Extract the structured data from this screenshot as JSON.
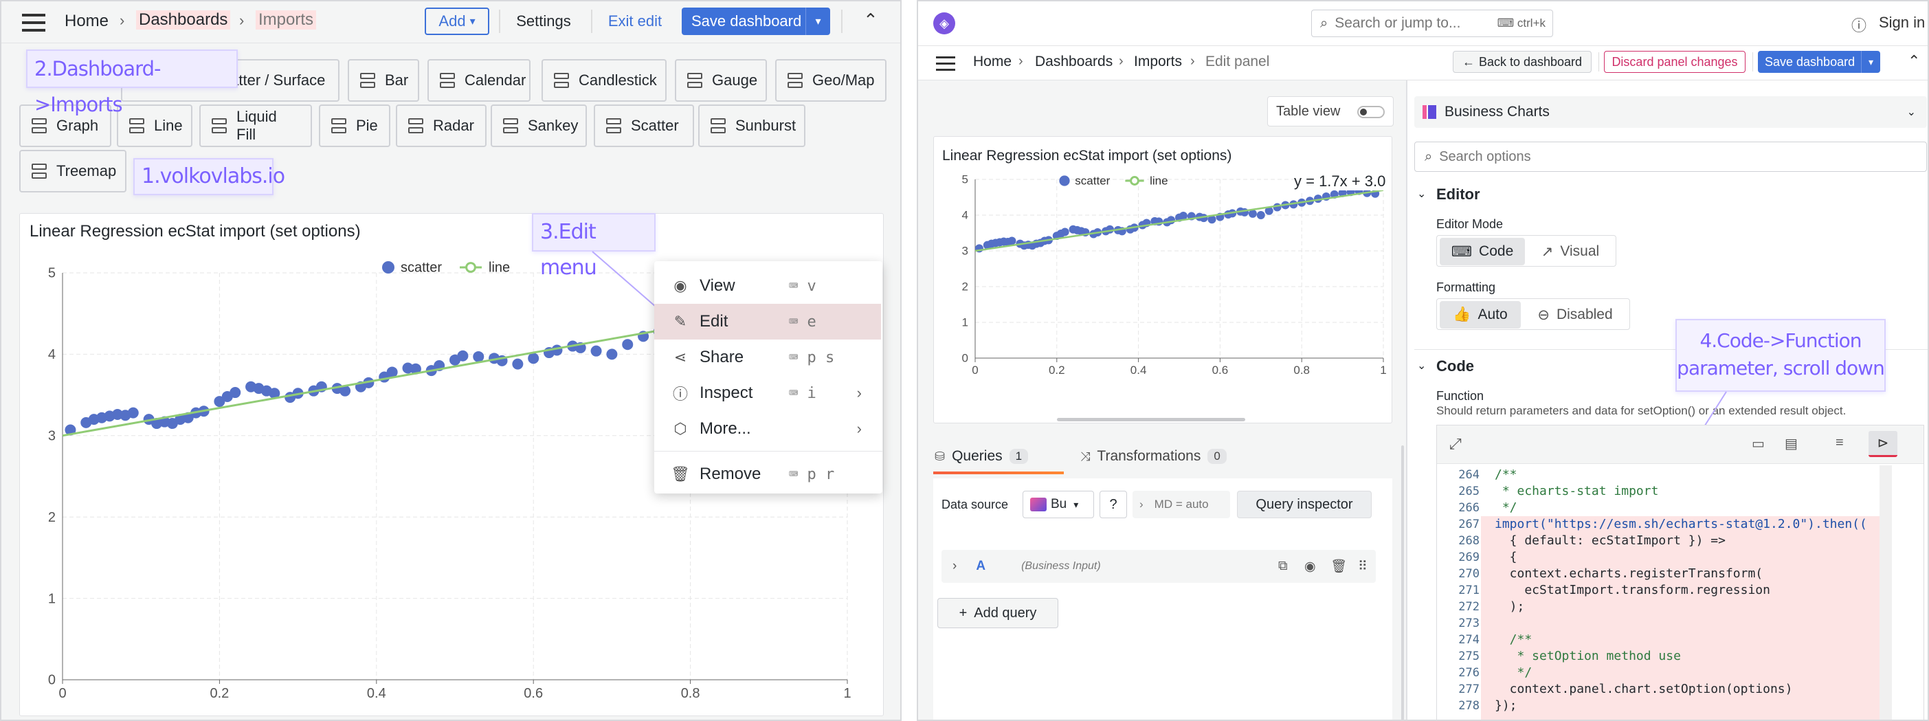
{
  "left": {
    "breadcrumb": {
      "home": "Home",
      "dashboards": "Dashboards",
      "imports": "Imports"
    },
    "toolbar": {
      "add": "Add",
      "settings": "Settings",
      "exit_edit": "Exit edit",
      "save": "Save dashboard"
    },
    "callouts": {
      "c1": "1.volkovlabs.io",
      "c2": "2.Dashboard->Imports",
      "c3": "3.Edit menu"
    },
    "links": [
      "3D Bar, Scatter / Surface",
      "Bar",
      "Calendar",
      "Candlestick",
      "Gauge",
      "Geo/Map",
      "Graph",
      "Line",
      "Liquid Fill",
      "Pie",
      "Radar",
      "Sankey",
      "Scatter",
      "Sunburst",
      "Treemap"
    ],
    "panel_title": "Linear Regression ecStat import (set options)",
    "menu": [
      {
        "label": "View",
        "key": "v"
      },
      {
        "label": "Edit",
        "key": "e"
      },
      {
        "label": "Share",
        "key": "p s"
      },
      {
        "label": "Inspect",
        "key": "i"
      },
      {
        "label": "More...",
        "key": ""
      },
      {
        "label": "Remove",
        "key": "p r"
      }
    ]
  },
  "right": {
    "search_placeholder": "Search or jump to...",
    "search_shortcut": "ctrl+k",
    "signin": "Sign in",
    "breadcrumb": {
      "home": "Home",
      "dashboards": "Dashboards",
      "imports": "Imports",
      "edit": "Edit panel"
    },
    "buttons": {
      "back": "Back to dashboard",
      "discard": "Discard panel changes",
      "save": "Save dashboard"
    },
    "table_view": "Table view",
    "panel_title": "Linear Regression ecStat import (set options)",
    "equation": "y = 1.7x + 3.0",
    "tabs": {
      "queries": "Queries",
      "queries_count": "1",
      "transformations": "Transformations",
      "transformations_count": "0"
    },
    "datasource": {
      "label": "Data source",
      "value": "Bu",
      "md": "MD = auto",
      "inspector": "Query inspector"
    },
    "query": {
      "letter": "A",
      "source": "(Business Input)"
    },
    "add_query": "Add query",
    "viz": "Business Charts",
    "options_search": "Search options",
    "editor": {
      "title": "Editor",
      "mode_label": "Editor Mode",
      "code": "Code",
      "visual": "Visual",
      "formatting_label": "Formatting",
      "auto": "Auto",
      "disabled": "Disabled"
    },
    "code": {
      "title": "Code",
      "function_label": "Function",
      "function_desc": "Should return parameters and data for setOption() or an extended result object."
    },
    "callout4": "4.Code->Function parameter, scroll down",
    "code_lines": [
      {
        "n": "264",
        "t": "/**"
      },
      {
        "n": "265",
        "t": " * echarts-stat import"
      },
      {
        "n": "266",
        "t": " */"
      },
      {
        "n": "267",
        "t": "import(\"https://esm.sh/echarts-stat@1.2.0\").then(("
      },
      {
        "n": "268",
        "t": "  { default: ecStatImport }) =>"
      },
      {
        "n": "269",
        "t": "  {"
      },
      {
        "n": "270",
        "t": "  context.echarts.registerTransform("
      },
      {
        "n": "271",
        "t": "    ecStatImport.transform.regression"
      },
      {
        "n": "272",
        "t": "  );"
      },
      {
        "n": "273",
        "t": ""
      },
      {
        "n": "274",
        "t": "  /**"
      },
      {
        "n": "275",
        "t": "   * setOption method use"
      },
      {
        "n": "276",
        "t": "   */"
      },
      {
        "n": "277",
        "t": "  context.panel.chart.setOption(options)"
      },
      {
        "n": "278",
        "t": "});"
      }
    ]
  },
  "chart_data": [
    {
      "type": "scatter",
      "title": "Linear Regression ecStat import (set options)",
      "legend": [
        "scatter",
        "line"
      ],
      "xlim": [
        0,
        1
      ],
      "ylim": [
        0,
        5
      ],
      "xticks": [
        "0",
        "0.2",
        "0.4",
        "0.6",
        "0.8",
        "1"
      ],
      "yticks": [
        "0",
        "1",
        "2",
        "3",
        "4",
        "5"
      ],
      "series": [
        {
          "name": "scatter",
          "x": [
            0.01,
            0.03,
            0.04,
            0.05,
            0.06,
            0.07,
            0.08,
            0.09,
            0.11,
            0.12,
            0.13,
            0.14,
            0.15,
            0.16,
            0.17,
            0.18,
            0.2,
            0.21,
            0.22,
            0.24,
            0.25,
            0.26,
            0.27,
            0.29,
            0.3,
            0.32,
            0.33,
            0.35,
            0.36,
            0.38,
            0.39,
            0.41,
            0.42,
            0.44,
            0.45,
            0.47,
            0.48,
            0.5,
            0.51,
            0.53,
            0.55,
            0.56,
            0.58,
            0.6,
            0.62,
            0.63,
            0.65,
            0.66,
            0.68,
            0.7,
            0.72,
            0.74,
            0.76,
            0.78,
            0.8,
            0.82,
            0.84,
            0.86,
            0.88,
            0.9,
            0.92,
            0.94,
            0.96,
            0.98
          ],
          "y": [
            3.07,
            3.16,
            3.2,
            3.22,
            3.24,
            3.26,
            3.25,
            3.28,
            3.2,
            3.15,
            3.17,
            3.15,
            3.2,
            3.22,
            3.28,
            3.3,
            3.42,
            3.48,
            3.53,
            3.6,
            3.58,
            3.55,
            3.52,
            3.47,
            3.52,
            3.55,
            3.6,
            3.58,
            3.55,
            3.6,
            3.65,
            3.72,
            3.78,
            3.83,
            3.82,
            3.8,
            3.86,
            3.93,
            3.98,
            3.97,
            3.95,
            3.92,
            3.88,
            3.95,
            4.02,
            4.05,
            4.1,
            4.08,
            4.04,
            4.0,
            4.12,
            4.22,
            4.28,
            4.3,
            4.35,
            4.4,
            4.46,
            4.52,
            4.58,
            4.62,
            4.65,
            4.68,
            4.62,
            4.6
          ]
        },
        {
          "name": "line",
          "x": [
            0,
            1
          ],
          "y": [
            3.0,
            4.7
          ]
        }
      ]
    },
    {
      "type": "scatter",
      "title": "Linear Regression ecStat import (set options)",
      "legend": [
        "scatter",
        "line"
      ],
      "xlim": [
        0,
        1
      ],
      "ylim": [
        0,
        5
      ],
      "xticks": [
        "0",
        "0.2",
        "0.4",
        "0.6",
        "0.8",
        "1"
      ],
      "yticks": [
        "0",
        "1",
        "2",
        "3",
        "4",
        "5"
      ],
      "series": [
        {
          "name": "scatter",
          "x": [
            0.01,
            0.03,
            0.04,
            0.05,
            0.06,
            0.07,
            0.08,
            0.09,
            0.11,
            0.12,
            0.13,
            0.14,
            0.15,
            0.16,
            0.17,
            0.18,
            0.2,
            0.21,
            0.22,
            0.24,
            0.25,
            0.26,
            0.27,
            0.29,
            0.3,
            0.32,
            0.33,
            0.35,
            0.36,
            0.38,
            0.39,
            0.41,
            0.42,
            0.44,
            0.45,
            0.47,
            0.48,
            0.5,
            0.51,
            0.53,
            0.55,
            0.56,
            0.58,
            0.6,
            0.62,
            0.63,
            0.65,
            0.66,
            0.68,
            0.7,
            0.72,
            0.74,
            0.76,
            0.78,
            0.8,
            0.82,
            0.84,
            0.86,
            0.88,
            0.9,
            0.92,
            0.94,
            0.96,
            0.98
          ],
          "y": [
            3.07,
            3.16,
            3.2,
            3.22,
            3.24,
            3.26,
            3.25,
            3.28,
            3.2,
            3.15,
            3.17,
            3.15,
            3.2,
            3.22,
            3.28,
            3.3,
            3.42,
            3.48,
            3.53,
            3.6,
            3.58,
            3.55,
            3.52,
            3.47,
            3.52,
            3.55,
            3.6,
            3.58,
            3.55,
            3.6,
            3.65,
            3.72,
            3.78,
            3.83,
            3.82,
            3.8,
            3.86,
            3.93,
            3.98,
            3.97,
            3.95,
            3.92,
            3.88,
            3.95,
            4.02,
            4.05,
            4.1,
            4.08,
            4.04,
            4.0,
            4.12,
            4.22,
            4.28,
            4.3,
            4.35,
            4.4,
            4.46,
            4.52,
            4.58,
            4.62,
            4.65,
            4.68,
            4.62,
            4.6
          ]
        },
        {
          "name": "line",
          "x": [
            0,
            1
          ],
          "y": [
            3.0,
            4.7
          ]
        }
      ]
    }
  ]
}
